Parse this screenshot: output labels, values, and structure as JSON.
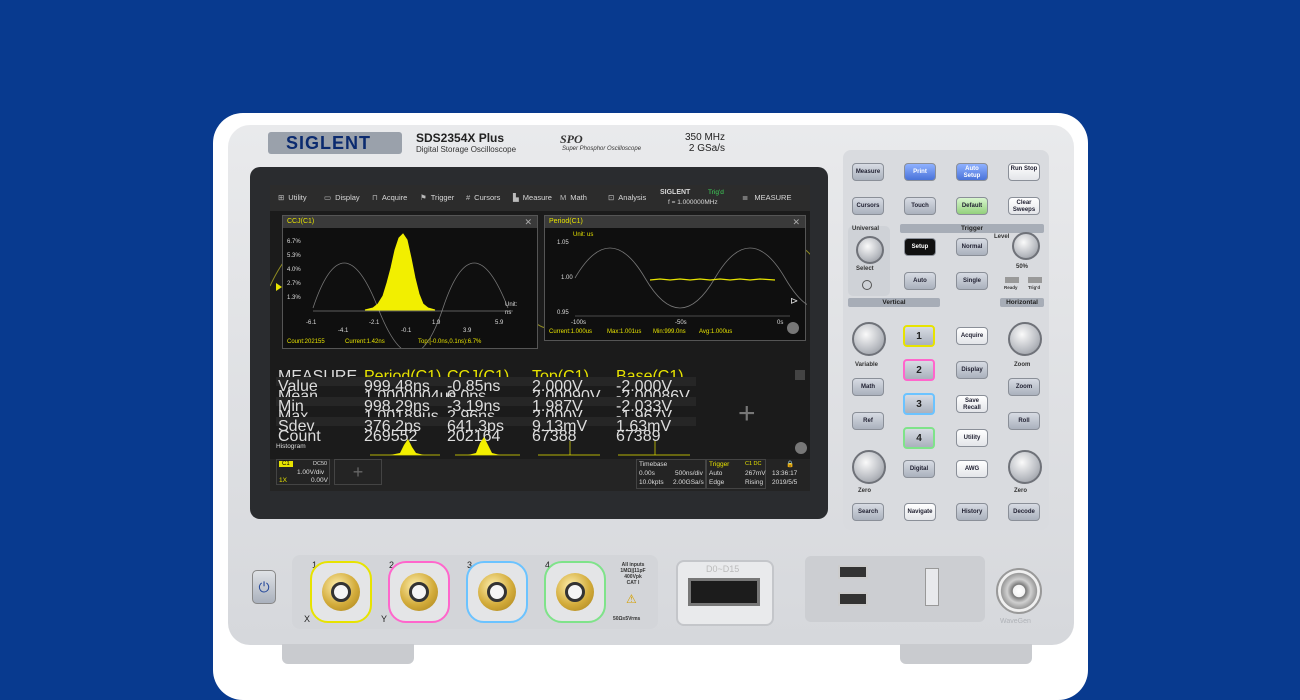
{
  "device": {
    "brand": "SIGLENT",
    "model": "SDS2354X  Plus",
    "subtitle": "Digital Storage Oscilloscope",
    "spo_logo": "SPO",
    "spo_sub": "Super Phosphor Oscilloscope",
    "bandwidth": "350 MHz",
    "sample_rate": "2 GSa/s"
  },
  "menu": {
    "utility": "Utility",
    "display": "Display",
    "acquire": "Acquire",
    "trigger": "Trigger",
    "cursors": "Cursors",
    "measure": "Measure",
    "math": "Math",
    "analysis": "Analysis",
    "brand": "SIGLENT",
    "trig_status": "Trig'd",
    "frequency": "f = 1.000000MHz",
    "measure_right": "MEASURE"
  },
  "windows": {
    "ccj": {
      "title": "CCJ(C1)",
      "y_labels": [
        "6.7%",
        "5.3%",
        "4.0%",
        "2.7%",
        "1.3%"
      ],
      "x_labels": [
        "-6.1",
        "-4.1",
        "-2.1",
        "-0.1",
        "1.9",
        "3.9",
        "5.9"
      ],
      "unit_label": "Unit:",
      "unit": "ns",
      "count": "Count:202155",
      "current": "Current:1.42ns",
      "top": "Top:[-0.0ns,0.1ns):6.7%"
    },
    "period": {
      "title": "Period(C1)",
      "unit": "Unit: us",
      "y_labels": [
        "1.05",
        "1.00",
        "0.95"
      ],
      "x_labels": [
        "-100s",
        "-50s",
        "0s"
      ],
      "current": "Current:1.000us",
      "max": "Max:1.001us",
      "min": "Min:999.0ns",
      "avg": "Avg:1.000us"
    }
  },
  "measure_table": {
    "headers": [
      "MEASURE",
      "Period(C1)",
      "CCJ(C1)",
      "Top(C1)",
      "Base(C1)"
    ],
    "rows": [
      {
        "label": "Value",
        "c1": "999.48ns",
        "c2": "-0.85ns",
        "c3": "2.000V",
        "c4": "-2.000V"
      },
      {
        "label": "Mean",
        "c1": "1.0000004us",
        "c2": "0.0ps",
        "c3": "2.00090V",
        "c4": "-2.00086V"
      },
      {
        "label": "Min",
        "c1": "998.29ns",
        "c2": "-3.19ns",
        "c3": "1.987V",
        "c4": "-2.033V"
      },
      {
        "label": "Max",
        "c1": "1.00189us",
        "c2": "2.96ns",
        "c3": "2.000V",
        "c4": "-1.967V"
      },
      {
        "label": "Sdev",
        "c1": "376.2ps",
        "c2": "641.3ps",
        "c3": "9.13mV",
        "c4": "1.63mV"
      },
      {
        "label": "Count",
        "c1": "269552",
        "c2": "202164",
        "c3": "67388",
        "c4": "67389"
      }
    ],
    "histogram": "Histogram"
  },
  "status": {
    "ch_badge": "C1",
    "coupling": "DC50",
    "vdiv": "1.00V/div",
    "probe": "1X",
    "offset": "0.00V",
    "timebase_title": "Timebase",
    "delay": "0.00s",
    "tdiv": "500ns/div",
    "mem": "10.0kpts",
    "srate": "2.00GSa/s",
    "trigger_title": "Trigger",
    "trig_src": "C1 DC",
    "trig_mode": "Auto",
    "trig_level": "267mV",
    "trig_type": "Edge",
    "trig_slope": "Rising",
    "time": "13:36:17",
    "date": "2019/5/5"
  },
  "panel": {
    "measure": "Measure",
    "print": "Print",
    "auto_setup": "Auto Setup",
    "run_stop": "Run Stop",
    "cursors": "Cursors",
    "touch": "Touch",
    "default": "Default",
    "clear_sweeps": "Clear Sweeps",
    "universal": "Universal",
    "select": "Select",
    "trigger": "Trigger",
    "setup": "Setup",
    "normal": "Normal",
    "level": "Level",
    "level_pct": "50%",
    "auto": "Auto",
    "single": "Single",
    "ready": "Ready",
    "trigd": "Trig'd",
    "vertical": "Vertical",
    "horizontal": "Horizontal",
    "variable": "Variable",
    "zoom_knob": "Zoom",
    "ch1": "1",
    "ch2": "2",
    "ch3": "3",
    "ch4": "4",
    "acquire": "Acquire",
    "display": "Display",
    "save_recall": "Save Recall",
    "utility": "Utility",
    "awg": "AWG",
    "math": "Math",
    "ref": "Ref",
    "digital": "Digital",
    "zoom": "Zoom",
    "roll": "Roll",
    "zero_v": "Zero",
    "zero_h": "Zero",
    "search": "Search",
    "navigate": "Navigate",
    "history": "History",
    "decode": "Decode"
  },
  "front": {
    "ch_labels": [
      "1",
      "2",
      "3",
      "4"
    ],
    "x": "X",
    "y": "Y",
    "all_inputs": "All inputs",
    "all_inputs_2": "1MΩ||11pF",
    "all_inputs_3": "400Vpk",
    "all_inputs_4": "CAT I",
    "rating": "50Ω≤5Vrms",
    "digital_port": "D0~D15",
    "waveGen": "WaveGen"
  },
  "colors": {
    "background": "#083a8f",
    "ch1": "#e7e300",
    "ch2": "#ff66cc",
    "ch3": "#6bc3ff",
    "ch4": "#7fe38a"
  }
}
